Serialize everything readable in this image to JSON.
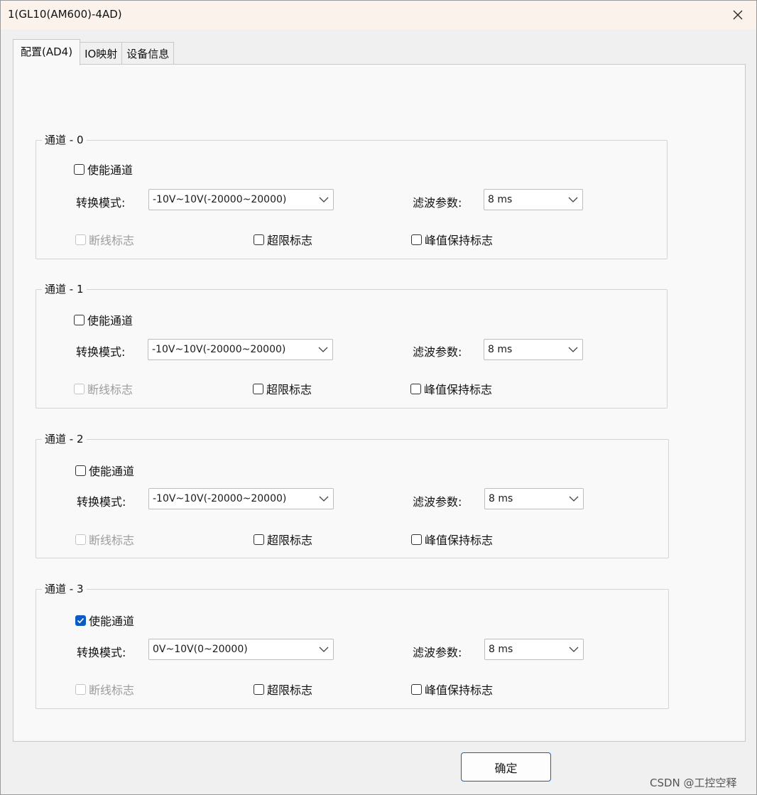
{
  "window": {
    "title": "1(GL10(AM600)-4AD)",
    "close_icon": "close-icon"
  },
  "tabs": [
    {
      "label": "配置(AD4)",
      "active": true
    },
    {
      "label": "IO映射",
      "active": false
    },
    {
      "label": "设备信息",
      "active": false
    }
  ],
  "channels": [
    {
      "title": "通道 - 0",
      "enable_label": "使能通道",
      "enabled": false,
      "mode_label": "转换模式:",
      "mode_value": "-10V~10V(-20000~20000)",
      "filter_label": "滤波参数:",
      "filter_value": "8 ms",
      "break_label": "断线标志",
      "overrange_label": "超限标志",
      "peak_label": "峰值保持标志"
    },
    {
      "title": "通道 - 1",
      "enable_label": "使能通道",
      "enabled": false,
      "mode_label": "转换模式:",
      "mode_value": "-10V~10V(-20000~20000)",
      "filter_label": "滤波参数:",
      "filter_value": "8 ms",
      "break_label": "断线标志",
      "overrange_label": "超限标志",
      "peak_label": "峰值保持标志"
    },
    {
      "title": "通道 - 2",
      "enable_label": "使能通道",
      "enabled": false,
      "mode_label": "转换模式:",
      "mode_value": "-10V~10V(-20000~20000)",
      "filter_label": "滤波参数:",
      "filter_value": "8 ms",
      "break_label": "断线标志",
      "overrange_label": "超限标志",
      "peak_label": "峰值保持标志"
    },
    {
      "title": "通道 - 3",
      "enable_label": "使能通道",
      "enabled": true,
      "mode_label": "转换模式:",
      "mode_value": "0V~10V(0~20000)",
      "filter_label": "滤波参数:",
      "filter_value": "8 ms",
      "break_label": "断线标志",
      "overrange_label": "超限标志",
      "peak_label": "峰值保持标志"
    }
  ],
  "footer": {
    "ok_label": "确定",
    "watermark": "CSDN @工控空释"
  },
  "colors": {
    "titlebar": "#fbf2ec",
    "accent": "#0a5bc2",
    "button_border": "#0067c0"
  }
}
